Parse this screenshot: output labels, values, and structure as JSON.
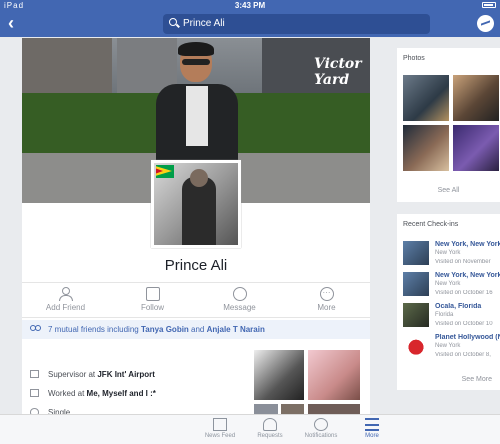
{
  "status": {
    "signal": "iPad",
    "time": "3:43 PM"
  },
  "header": {
    "search_value": "Prince Ali"
  },
  "profile": {
    "name": "Prince Ali",
    "cover_sign": "Victor Yard",
    "actions": [
      {
        "label": "Add Friend",
        "icon": "add-friend-icon"
      },
      {
        "label": "Follow",
        "icon": "follow-icon"
      },
      {
        "label": "Message",
        "icon": "messenger-icon"
      },
      {
        "label": "More",
        "icon": "more-icon"
      }
    ],
    "mutual": {
      "prefix": "7 mutual friends including ",
      "friend1": "Tanya Gobin",
      "joiner": " and ",
      "friend2": "Anjale T Narain"
    },
    "details": [
      {
        "prefix": "Supervisor at ",
        "bold": "JFK Int' Airport"
      },
      {
        "prefix": "Worked at ",
        "bold": "Me, Myself and I :*"
      },
      {
        "prefix": "Single",
        "bold": ""
      }
    ]
  },
  "photos": {
    "title": "Photos",
    "see_all": "See All"
  },
  "checkins": {
    "title": "Recent Check-ins",
    "items": [
      {
        "place": "New York, New York",
        "sub": "New York",
        "visited": "Visited on November"
      },
      {
        "place": "New York, New York",
        "sub": "New York",
        "visited": "Visited on October 16"
      },
      {
        "place": "Ocala, Florida",
        "sub": "Florida",
        "visited": "Visited on October 10"
      },
      {
        "place": "Planet Hollywood (N",
        "sub": "New York",
        "visited": "Visited on October 8,"
      }
    ],
    "see_more": "See More"
  },
  "tabbar": [
    {
      "label": "News Feed"
    },
    {
      "label": "Requests"
    },
    {
      "label": "Notifications"
    },
    {
      "label": "More",
      "active": true
    }
  ],
  "colors": {
    "brand": "#4267b2",
    "link": "#365899"
  }
}
